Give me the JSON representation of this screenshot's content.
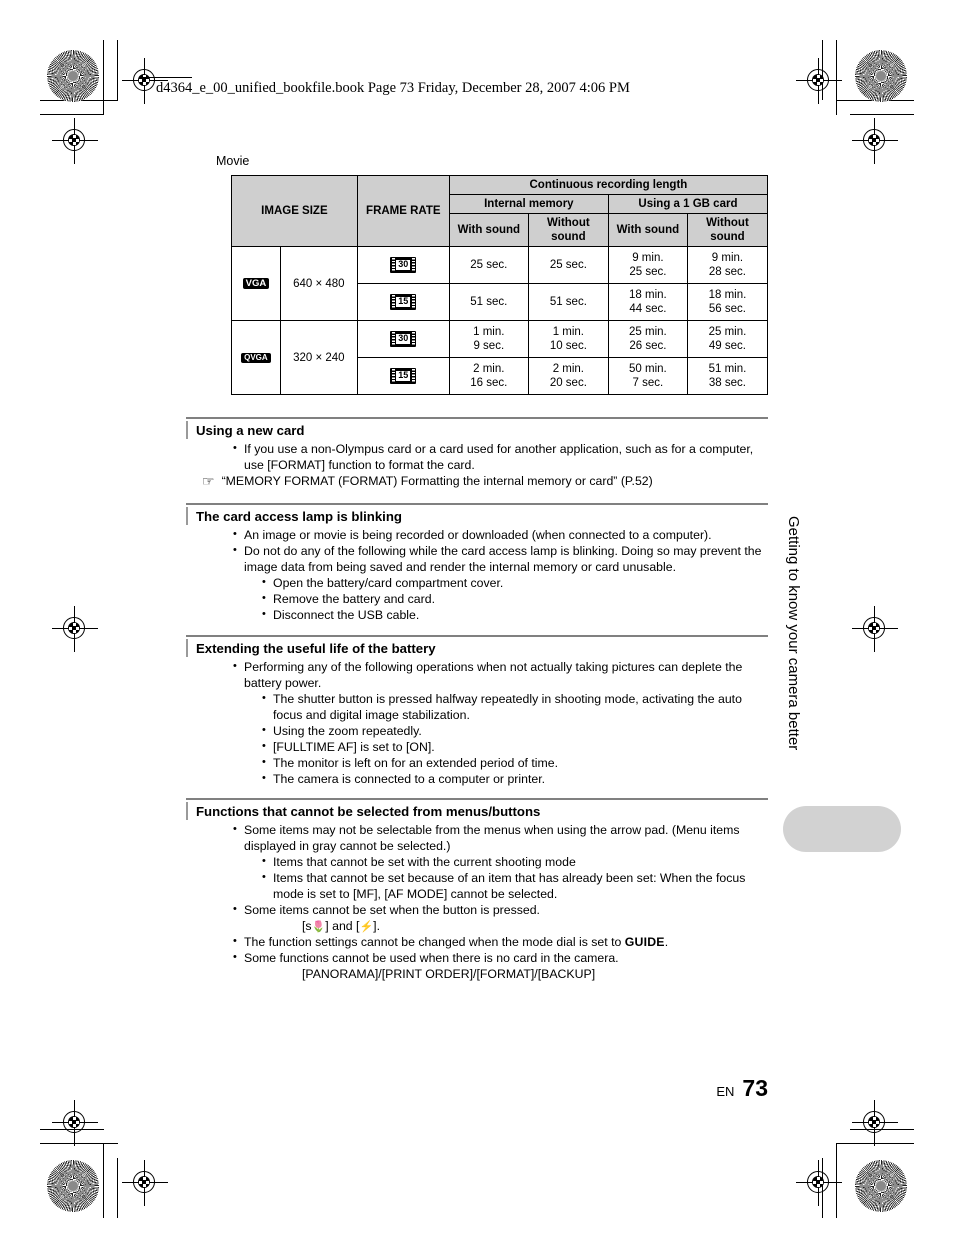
{
  "header": {
    "bookline": "d4364_e_00_unified_bookfile.book  Page 73  Friday, December 28, 2007  4:06 PM"
  },
  "table_label": "Movie",
  "table": {
    "headers": {
      "image_size": "IMAGE SIZE",
      "frame_rate": "FRAME RATE",
      "continuous": "Continuous recording length",
      "internal_memory": "Internal memory",
      "card_1gb": "Using a 1 GB card",
      "with_sound_a": "With sound",
      "without_sound_a": "Without sound",
      "with_sound_b": "With sound",
      "without_sound_b": "Without sound"
    },
    "rows": [
      {
        "badge": "VGA",
        "badge_style": "vga",
        "dimensions": "640 × 480",
        "rates": [
          {
            "icon": "film-strip-30fps-icon",
            "fps": "30",
            "internal_with": "25 sec.",
            "internal_without": "25 sec.",
            "card_with": "9 min.\n25 sec.",
            "card_without": "9 min.\n28 sec."
          },
          {
            "icon": "film-strip-15fps-icon",
            "fps": "15",
            "internal_with": "51 sec.",
            "internal_without": "51 sec.",
            "card_with": "18 min.\n44 sec.",
            "card_without": "18 min.\n56 sec."
          }
        ]
      },
      {
        "badge": "QVGA",
        "badge_style": "qvga",
        "dimensions": "320 × 240",
        "rates": [
          {
            "icon": "film-strip-30fps-icon",
            "fps": "30",
            "internal_with": "1 min.\n9 sec.",
            "internal_without": "1 min.\n10 sec.",
            "card_with": "25 min.\n26 sec.",
            "card_without": "25 min.\n49 sec."
          },
          {
            "icon": "film-strip-15fps-icon",
            "fps": "15",
            "internal_with": "2 min.\n16 sec.",
            "internal_without": "2 min.\n20 sec.",
            "card_with": "50 min.\n7 sec.",
            "card_without": "51 min.\n38 sec."
          }
        ]
      }
    ]
  },
  "sections": [
    {
      "id": "using-a-new-card",
      "title": "Using a new card",
      "bullets": [
        "If you use a non-Olympus card or a card used for another application, such as for a computer, use [FORMAT] function to format the card."
      ],
      "reference": "“MEMORY FORMAT (FORMAT) Formatting the internal memory or card” (P.52)",
      "reference_icon": "pointing-hand-icon"
    },
    {
      "id": "card-access-lamp-blinking",
      "title": "The card access lamp is blinking",
      "bullets": [
        "An image or movie is being recorded or downloaded (when connected to a computer).",
        "Do not do any of the following while the card access lamp is blinking. Doing so may prevent the image data from being saved and render the internal memory or card unusable."
      ],
      "subbullets": [
        "Open the battery/card compartment cover.",
        "Remove the battery and card.",
        "Disconnect the USB cable."
      ]
    },
    {
      "id": "extending-battery-life",
      "title": "Extending the useful life of the battery",
      "bullets": [
        "Performing any of the following operations when not actually taking pictures can deplete the battery power."
      ],
      "subbullets": [
        "The shutter button is pressed halfway repeatedly in shooting mode, activating the auto focus and digital image stabilization.",
        "Using the zoom repeatedly.",
        "[FULLTIME AF] is set to [ON].",
        "The monitor is left on for an extended period of time.",
        "The camera is connected to a computer or printer."
      ]
    },
    {
      "id": "functions-not-selectable",
      "title": "Functions that cannot be selected from menus/buttons",
      "bullet_1": "Some items may not be selectable from the menus when using the arrow pad. (Menu items displayed in gray cannot be selected.)",
      "subbullets_1": [
        "Items that cannot be set with the current shooting mode",
        "Items that cannot be set because of an item that has already been set: When the focus mode is set to [MF], [AF MODE] cannot be selected."
      ],
      "bullet_2": "Some items cannot be set when the button is pressed.",
      "bullet_2_detail_pre": "[s",
      "bullet_2_detail_mid": "] and [",
      "bullet_2_detail_post": "].",
      "bullet_2_icon_macro": "macro-flower-icon",
      "bullet_2_icon_flash": "flash-bolt-icon",
      "bullet_3_pre": "The function settings cannot be changed when the mode dial is set to ",
      "bullet_3_guide": "GUIDE",
      "bullet_3_post": ".",
      "bullet_4": "Some functions cannot be used when there is no card in the camera.",
      "bullet_4_detail": "[PANORAMA]/[PRINT ORDER]/[FORMAT]/[BACKUP]"
    }
  ],
  "side_tab_text": "Getting to know your camera better",
  "footer": {
    "language": "EN",
    "page_number": "73"
  },
  "colors": {
    "table_header_bg": "#cfcfcf",
    "section_rule": "#808080",
    "side_tab": "#d2d2d2",
    "text": "#000000"
  }
}
